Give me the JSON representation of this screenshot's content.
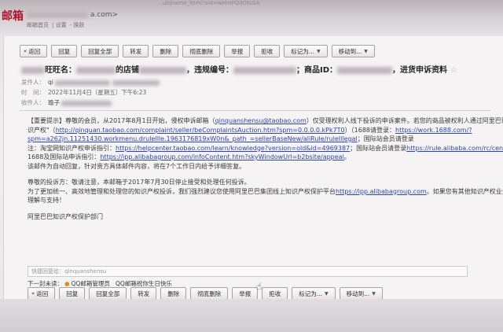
{
  "header": {
    "logo": "邮箱",
    "mailbox_suffix": "a.com>",
    "url_fragment": "…ubjname_html?sid=wHmPQd0YuSA",
    "user_links": [
      "邮箱首页",
      "设置",
      "换肤"
    ]
  },
  "toolbar": {
    "buttons": [
      {
        "label": "返回",
        "icon": "back-arrow-icon"
      },
      {
        "label": "回复"
      },
      {
        "label": "回复全部"
      },
      {
        "label": "转发"
      },
      {
        "label": "删除"
      },
      {
        "label": "彻底删除"
      },
      {
        "label": "举报"
      },
      {
        "label": "拒收"
      },
      {
        "label": "标记为...",
        "dropdown": true
      },
      {
        "label": "移动到...",
        "dropdown": true
      }
    ]
  },
  "mail": {
    "subject_prefix": "旺旺名：",
    "subject_shop": "的店铺",
    "subject_mid": "，违规编号：",
    "subject_product": "；商品ID：",
    "subject_suffix": "，进货申诉资料",
    "sender_label": "发件人：",
    "sender_name": "qi",
    "time_label": "时　间：",
    "time_value": "2022年11月4日（星期五）下午6:23",
    "recipient_label": "收件人：",
    "recipient_name": "瑜子"
  },
  "body": {
    "line1": "【重要提示】尊敬的会员，从2017年8月1日开始，侵权申诉邮箱（",
    "line1_link": "qinquanshensu@taobao.com",
    "line1_tail": "）仅受理权利人线下投诉的申诉案件。若您的商品被权利人通过阿里巴巴知",
    "line2": "识产权\"（",
    "line2_link": "http://qinquan.taobao.com/complaint/seller/beComplaintsAuction.htm?spm=0.0.0.0.kPk7T0",
    "line2_tail": "）（1688请登录：",
    "line2_link2": "https://work.1688.com/?",
    "line3_link": "spm=a262jn.11251430.workmenu.druleIlle.1963176819xW0n&_path_=sellerBaseNew/aliRule/ruleIllegal",
    "line3_tail": "；国际站会员请登录",
    "line4": "注：淘宝网知识产权申诉指引：",
    "line4_link": "https://helpcenter.taobao.com/learn/knowledge?version=old&id=4969387",
    "line4_tail": "；国际站会员请登录",
    "line4_link2": "https://rule.alibaba.com/rc/cen",
    "line5": "1688及国际站申诉指引：",
    "line5_link": "https://ipp.alibabagroup.com/infoContent.htm?skyWindowUrl=b2bsite/appeal",
    "line5_tail": "。",
    "line6": "该邮件为自动回复，针对贵方具体邮件内容，将在7个工作日内给予详细答复。",
    "line7": "尊敬的投诉方：敬请注意，本邮箱于2017年7月30日停止接受和处理任何投诉。",
    "line8": "为了更加统一、高效地管理和处理您的知识产权投诉，我们强烈建议您使用阿里巴巴集团线上知识产权保护平台",
    "line8_link": "https://ipp.alibabagroup.com",
    "line8_tail": "。如果您有其他知识产权业务，",
    "line9": "理解与支持！",
    "signature": "阿里巴巴知识产权保护部门"
  },
  "quick_reply": {
    "placeholder": "快捷回复给：qinquanshensu"
  },
  "next_mail": {
    "label": "下一封未读：",
    "items": [
      "QQ邮箱管理员",
      "QQ邮箱祝你生日快乐"
    ]
  }
}
